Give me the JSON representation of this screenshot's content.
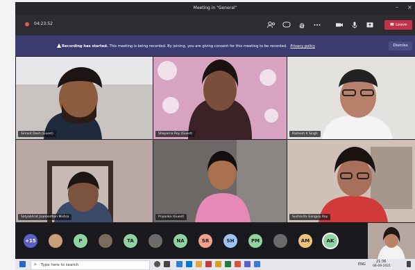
{
  "window": {
    "title": "Meeting in \"General\"",
    "minimize": "–",
    "close": "×"
  },
  "toolbar": {
    "timer": "04:23:52",
    "leave_label": "Leave"
  },
  "banner": {
    "heading": "Recording has started.",
    "message": "This meeting is being recorded. By joining, you are giving consent for this meeting to be recorded.",
    "link": "Privacy policy",
    "dismiss_label": "Dismiss"
  },
  "participants": [
    {
      "name": "Simant Dash (Guest)"
    },
    {
      "name": "Shaparna Roy (Guest)"
    },
    {
      "name": "Ramesh K Singh"
    },
    {
      "name": "Satyabhrat Jnanbodhan Mishra"
    },
    {
      "name": "Priyanka (Guest)"
    },
    {
      "name": "Sucharita Ganguly Roy"
    }
  ],
  "roster": [
    {
      "initials": "+15",
      "color": "#5b5fc7"
    },
    {
      "initials": "",
      "color": "#c9a27a"
    },
    {
      "initials": "P",
      "color": "#8fd3a3"
    },
    {
      "initials": "",
      "color": "#7a6b5f"
    },
    {
      "initials": "TA",
      "color": "#8fd3a3"
    },
    {
      "initials": "",
      "color": "#6f6a6a"
    },
    {
      "initials": "NA",
      "color": "#8fd3a3"
    },
    {
      "initials": "SR",
      "color": "#f0a08c"
    },
    {
      "initials": "SH",
      "color": "#9cc4f2"
    },
    {
      "initials": "PM",
      "color": "#8fd3a3"
    },
    {
      "initials": "",
      "color": "#6b6b6b"
    },
    {
      "initials": "AM",
      "color": "#f0c27a"
    },
    {
      "initials": "AK",
      "color": "#8fd3a3"
    }
  ],
  "taskbar": {
    "search_placeholder": "Type here to search",
    "time": "21:36",
    "date": "08-09-2021",
    "lang": "ENG"
  }
}
